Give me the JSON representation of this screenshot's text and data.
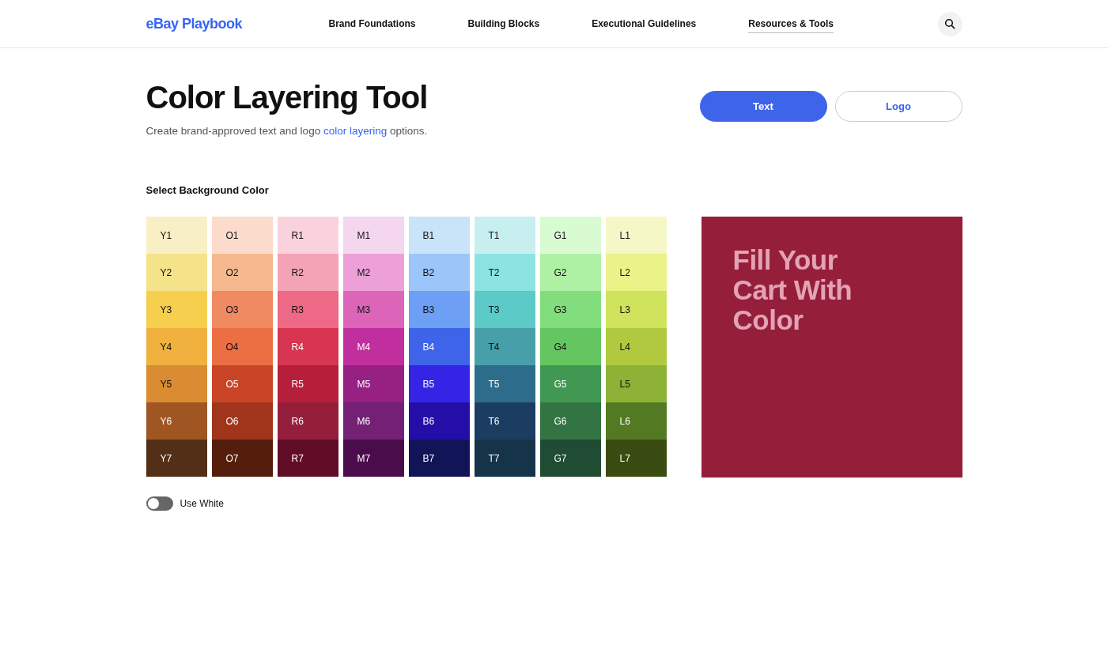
{
  "header": {
    "logo": "eBay Playbook",
    "nav": [
      {
        "label": "Brand Foundations",
        "selected": false
      },
      {
        "label": "Building Blocks",
        "selected": false
      },
      {
        "label": "Executional Guidelines",
        "selected": false
      },
      {
        "label": "Resources & Tools",
        "selected": true
      }
    ]
  },
  "hero": {
    "title": "Color Layering Tool",
    "subtitle_before": "Create brand-approved text and logo ",
    "subtitle_link": "color layering",
    "subtitle_after": " options.",
    "modes": [
      {
        "label": "Text",
        "selected": true
      },
      {
        "label": "Logo",
        "selected": false
      }
    ]
  },
  "palette": {
    "heading": "Select Background Color",
    "columns": [
      [
        {
          "label": "Y1",
          "color": "#f8f0c4"
        },
        {
          "label": "Y2",
          "color": "#f5e38a"
        },
        {
          "label": "Y3",
          "color": "#f6cf4f"
        },
        {
          "label": "Y4",
          "color": "#f0b13f"
        },
        {
          "label": "Y5",
          "color": "#d98c31"
        },
        {
          "label": "Y6",
          "color": "#9f5622"
        },
        {
          "label": "Y7",
          "color": "#532f17"
        }
      ],
      [
        {
          "label": "O1",
          "color": "#fbdccc"
        },
        {
          "label": "O2",
          "color": "#f6b98f"
        },
        {
          "label": "O3",
          "color": "#f08a61"
        },
        {
          "label": "O4",
          "color": "#ec6f43"
        },
        {
          "label": "O5",
          "color": "#c94525"
        },
        {
          "label": "O6",
          "color": "#a1351c"
        },
        {
          "label": "O7",
          "color": "#551e0c"
        }
      ],
      [
        {
          "label": "R1",
          "color": "#f9d2de"
        },
        {
          "label": "R2",
          "color": "#f3a3b5"
        },
        {
          "label": "R3",
          "color": "#ed6985"
        },
        {
          "label": "R4",
          "color": "#d73550"
        },
        {
          "label": "R5",
          "color": "#b51f3a"
        },
        {
          "label": "R6",
          "color": "#951e3b"
        },
        {
          "label": "R7",
          "color": "#620d28"
        }
      ],
      [
        {
          "label": "M1",
          "color": "#f4d6ee"
        },
        {
          "label": "M2",
          "color": "#eca0d7"
        },
        {
          "label": "M3",
          "color": "#dc65b9"
        },
        {
          "label": "M4",
          "color": "#c12f9e"
        },
        {
          "label": "M5",
          "color": "#972083"
        },
        {
          "label": "M6",
          "color": "#742074"
        },
        {
          "label": "M7",
          "color": "#4a0c4b"
        }
      ],
      [
        {
          "label": "B1",
          "color": "#c9e3f8"
        },
        {
          "label": "B2",
          "color": "#9cc6fa"
        },
        {
          "label": "B3",
          "color": "#6d9ff5"
        },
        {
          "label": "B4",
          "color": "#3e64ea"
        },
        {
          "label": "B5",
          "color": "#3425e6"
        },
        {
          "label": "B6",
          "color": "#230fa8"
        },
        {
          "label": "B7",
          "color": "#121458"
        }
      ],
      [
        {
          "label": "T1",
          "color": "#c8eff0"
        },
        {
          "label": "T2",
          "color": "#8be3e2"
        },
        {
          "label": "T3",
          "color": "#5ccac6"
        },
        {
          "label": "T4",
          "color": "#47a0a9"
        },
        {
          "label": "T5",
          "color": "#2d6c8b"
        },
        {
          "label": "T6",
          "color": "#1c3d62"
        },
        {
          "label": "T7",
          "color": "#153349"
        }
      ],
      [
        {
          "label": "G1",
          "color": "#d9fbd2"
        },
        {
          "label": "G2",
          "color": "#aff1a4"
        },
        {
          "label": "G3",
          "color": "#82de7c"
        },
        {
          "label": "G4",
          "color": "#64c660"
        },
        {
          "label": "G5",
          "color": "#409853"
        },
        {
          "label": "G6",
          "color": "#337443"
        },
        {
          "label": "G7",
          "color": "#1f4c33"
        }
      ],
      [
        {
          "label": "L1",
          "color": "#f5f7c7"
        },
        {
          "label": "L2",
          "color": "#ebf287"
        },
        {
          "label": "L3",
          "color": "#d0e35c"
        },
        {
          "label": "L4",
          "color": "#b1c93e"
        },
        {
          "label": "L5",
          "color": "#8db235"
        },
        {
          "label": "L6",
          "color": "#537a22"
        },
        {
          "label": "L7",
          "color": "#3a4c12"
        }
      ]
    ],
    "toggle": {
      "label": "Use White",
      "on": false
    }
  },
  "preview": {
    "color": "#951e3b",
    "headline": [
      "Fill Your",
      "Cart With",
      "Color"
    ]
  }
}
